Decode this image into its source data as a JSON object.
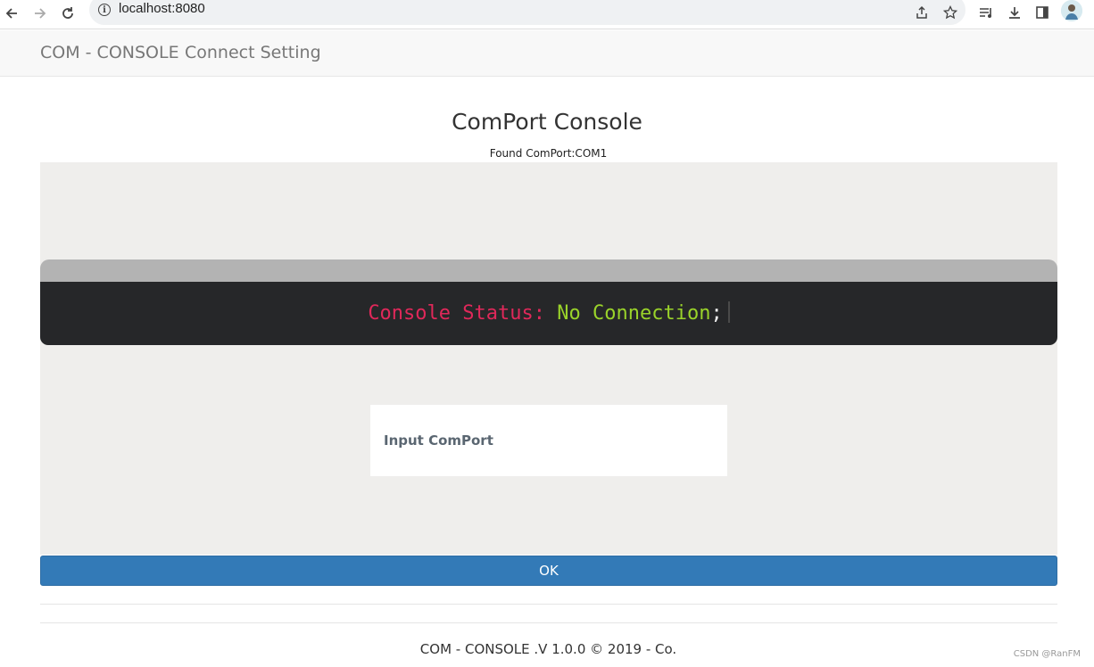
{
  "browser": {
    "url": "localhost:8080"
  },
  "navbar": {
    "brand": "COM - CONSOLE",
    "link": "Connect Setting"
  },
  "main": {
    "title": "ComPort Console",
    "found_port": "Found ComPort:COM1",
    "console": {
      "key": "Console Status:",
      "value": "No Connection",
      "terminator": ";"
    },
    "input_label": "Input ComPort",
    "ok_button": "OK"
  },
  "footer": {
    "text": "COM - CONSOLE .V 1.0.0 © 2019 - Co."
  },
  "watermark": "CSDN @RanFM",
  "colors": {
    "primary_button": "#337ab7",
    "terminal_bg": "#262729",
    "status_key": "#e0285a",
    "status_value": "#9ad32a"
  }
}
